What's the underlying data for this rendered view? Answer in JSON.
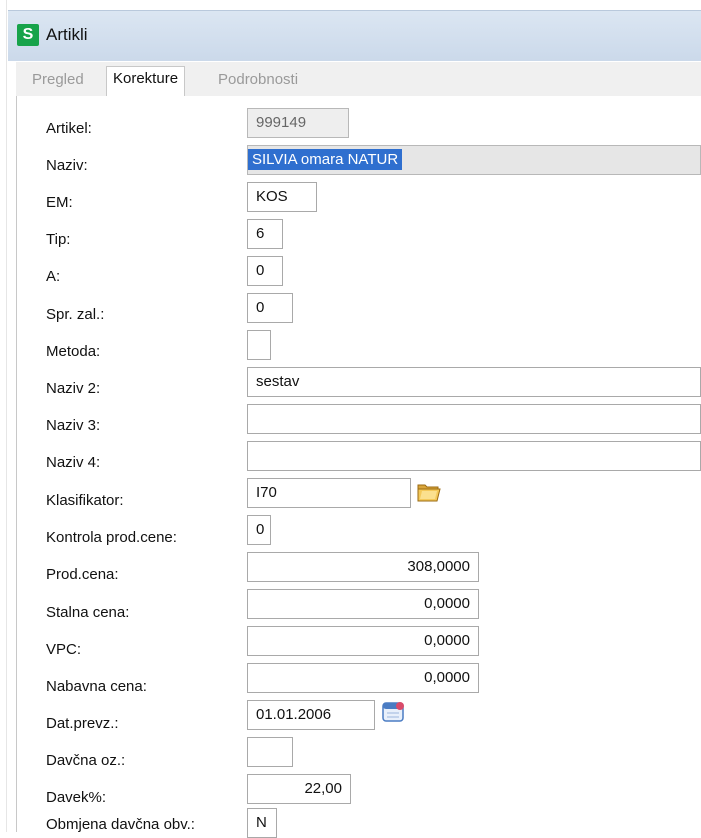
{
  "window": {
    "title": "Artikli",
    "app_icon_letter": "S"
  },
  "tabs": [
    {
      "label": "Pregled",
      "state": "disabled"
    },
    {
      "label": "Korekture",
      "state": "active"
    },
    {
      "label": "Podrobnosti",
      "state": "disabled"
    }
  ],
  "form": {
    "artikel": {
      "label": "Artikel:",
      "value": "999149"
    },
    "naziv": {
      "label": "Naziv:",
      "value": "SILVIA omara NATUR"
    },
    "em": {
      "label": "EM:",
      "value": "KOS"
    },
    "tip": {
      "label": "Tip:",
      "value": "6"
    },
    "a": {
      "label": "A:",
      "value": "0"
    },
    "spr_zal": {
      "label": "Spr. zal.:",
      "value": "0"
    },
    "metoda": {
      "label": "Metoda:",
      "value": ""
    },
    "naziv2": {
      "label": "Naziv 2:",
      "value": "sestav"
    },
    "naziv3": {
      "label": "Naziv 3:",
      "value": ""
    },
    "naziv4": {
      "label": "Naziv 4:",
      "value": ""
    },
    "klasifikator": {
      "label": "Klasifikator:",
      "value": "I70"
    },
    "kontrola_prod_cene": {
      "label": "Kontrola prod.cene:",
      "value": "0"
    },
    "prod_cena": {
      "label": "Prod.cena:",
      "value": "308,0000"
    },
    "stalna_cena": {
      "label": "Stalna cena:",
      "value": "0,0000"
    },
    "vpc": {
      "label": "VPC:",
      "value": "0,0000"
    },
    "nabavna_cena": {
      "label": "Nabavna cena:",
      "value": "0,0000"
    },
    "dat_prevz": {
      "label": "Dat.prevz.:",
      "value": "01.01.2006"
    },
    "davcna_oz": {
      "label": "Davčna oz.:",
      "value": ""
    },
    "davek": {
      "label": "Davek%:",
      "value": "22,00"
    },
    "obmjena": {
      "label": "Obmjena davčna obv.:",
      "value": "N"
    }
  },
  "icons": {
    "folder": "folder-open-icon",
    "calendar": "calendar-icon"
  },
  "colors": {
    "titlebar": "#cbd9ea",
    "app_icon": "#17a34a",
    "selection": "#2f6fcf"
  }
}
